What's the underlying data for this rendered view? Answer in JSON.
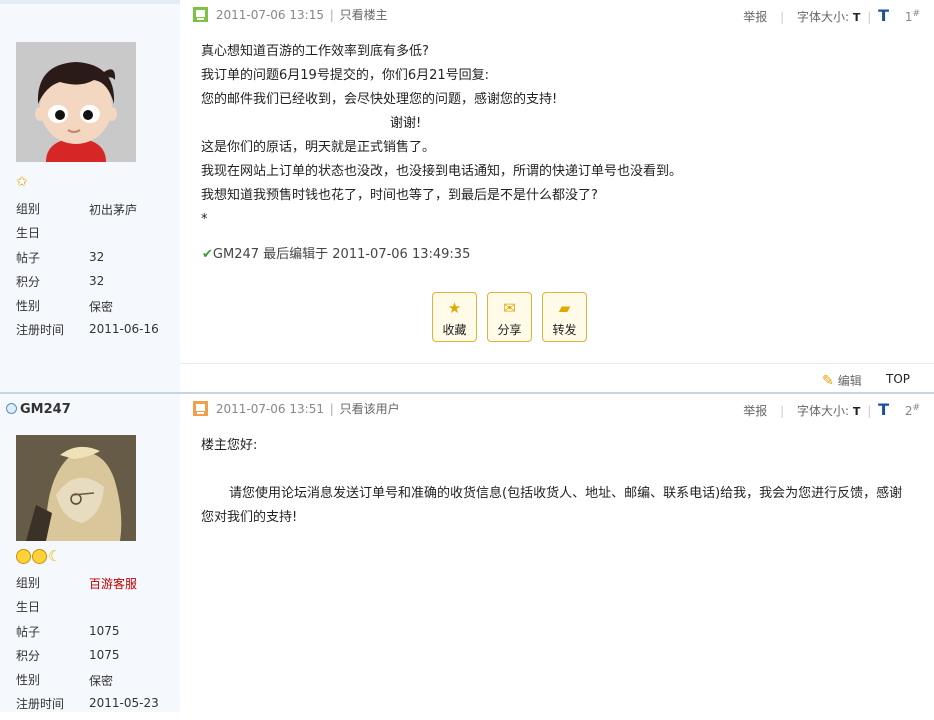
{
  "post1": {
    "author": {
      "group_label": "组别",
      "group": "初出茅庐",
      "birthday_label": "生日",
      "birthday": "",
      "posts_label": "帖子",
      "posts": "32",
      "points_label": "积分",
      "points": "32",
      "gender_label": "性别",
      "gender": "保密",
      "registered_label": "注册时间",
      "registered": "2011-06-16"
    },
    "header": {
      "time": "2011-07-06 13:15",
      "only_link": "只看楼主",
      "report": "举报",
      "font_size_label": "字体大小:",
      "font_small": "T",
      "font_big": "T",
      "floor": "1",
      "floor_mark": "#"
    },
    "content": [
      "真心想知道百游的工作效率到底有多低?",
      "我订单的问题6月19号提交的，你们6月21号回复:",
      "您的邮件我们已经收到，会尽快处理您的问题，感谢您的支持!",
      "谢谢!",
      "这是你们的原话，明天就是正式销售了。",
      "我现在网站上订单的状态也没改，也没接到电话通知，所谓的快递订单号也没看到。",
      "我想知道我预售时钱也花了，时间也等了，到最后是不是什么都没了?",
      "*"
    ],
    "edit_note": "GM247 最后编辑于  2011-07-06 13:49:35",
    "actions": {
      "favorite": "收藏",
      "share": "分享",
      "forward": "转发"
    },
    "footer": {
      "edit": "编辑",
      "top": "TOP"
    }
  },
  "post2": {
    "author": {
      "name": "GM247",
      "group_label": "组别",
      "group": "百游客服",
      "birthday_label": "生日",
      "birthday": "",
      "posts_label": "帖子",
      "posts": "1075",
      "points_label": "积分",
      "points": "1075",
      "gender_label": "性别",
      "gender": "保密",
      "registered_label": "注册时间",
      "registered": "2011-05-23"
    },
    "header": {
      "time": "2011-07-06 13:51",
      "only_link": "只看该用户",
      "report": "举报",
      "font_size_label": "字体大小:",
      "font_small": "T",
      "font_big": "T",
      "floor": "2",
      "floor_mark": "#"
    },
    "content": {
      "greeting": "楼主您好:",
      "body": "请您使用论坛消息发送订单号和准确的收货信息(包括收货人、地址、邮编、联系电话)给我，我会为您进行反馈，感谢您对我们的支持!"
    }
  },
  "colors": {
    "sidebar_bg": "#f5f9fd",
    "accent_blue": "#1d4f9a",
    "staff_red": "#c00000",
    "button_border": "#e1b13a"
  }
}
